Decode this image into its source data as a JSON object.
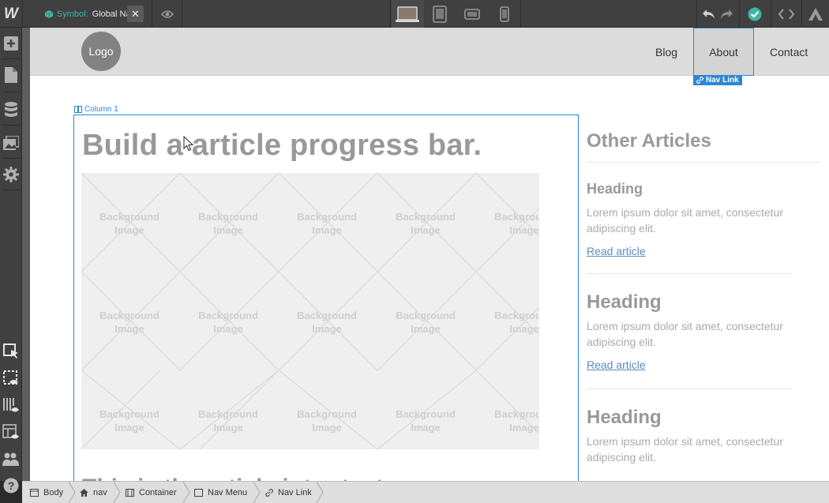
{
  "topbar": {
    "app_logo": "W",
    "symbol_label": "Symbol:",
    "symbol_name": "Global Nav",
    "close_glyph": "✕",
    "devices": [
      "desktop-icon",
      "tablet-icon",
      "landscape-phone-icon",
      "phone-icon"
    ],
    "accent_color": "#3fb4a6"
  },
  "leftbar": {
    "top_tools": [
      "add-icon",
      "pages-icon",
      "cms-icon",
      "assets-icon",
      "settings-icon"
    ],
    "bottom_tools": [
      "select-tool-icon",
      "preview-element-icon",
      "grid-preview-icon",
      "layout-preview-icon",
      "users-icon",
      "help-icon"
    ]
  },
  "canvas": {
    "logo_text": "Logo",
    "nav_links": [
      "Blog",
      "About",
      "Contact"
    ],
    "selected_tag": "Nav Link",
    "column_tag": "Column 1",
    "article_title": "Build a article progress bar.",
    "bg_label_line1": "Background",
    "bg_label_line2": "Image",
    "cut_heading": "This is the article intro text",
    "selection_color": "#2f86d3"
  },
  "sidebar": {
    "title": "Other Articles",
    "articles": [
      {
        "heading": "Heading",
        "body": "Lorem ipsum dolor sit amet, consectetur adipiscing elit.",
        "link": "Read article"
      },
      {
        "heading": "Heading",
        "body": "Lorem ipsum dolor sit amet, consectetur adipiscing elit.",
        "link": "Read article"
      },
      {
        "heading": "Heading",
        "body": "Lorem ipsum dolor sit amet, consectetur adipiscing elit."
      }
    ]
  },
  "breadcrumbs": [
    {
      "label": "Body",
      "icon": "body-icon"
    },
    {
      "label": "nav",
      "icon": "home-icon"
    },
    {
      "label": "Container",
      "icon": "container-icon"
    },
    {
      "label": "Nav Menu",
      "icon": "nav-menu-icon"
    },
    {
      "label": "Nav Link",
      "icon": "link-icon"
    }
  ]
}
